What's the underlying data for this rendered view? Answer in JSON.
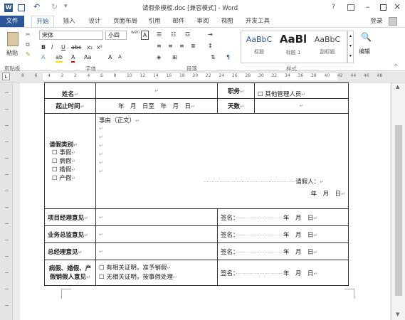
{
  "window": {
    "title": "请假条模板.doc [兼容模式] - Word",
    "help": "?",
    "signin": "登录"
  },
  "tabs": [
    "文件",
    "开始",
    "插入",
    "设计",
    "页面布局",
    "引用",
    "邮件",
    "审阅",
    "视图",
    "开发工具"
  ],
  "ribbon": {
    "paste": "粘贴",
    "font_name": "宋体",
    "font_size": "小四",
    "wen": "wén",
    "styles": [
      {
        "preview": "AaBbC",
        "name": "标题"
      },
      {
        "preview": "AaBl",
        "name": "标题 1"
      },
      {
        "preview": "AaBbC",
        "name": "副标题"
      }
    ],
    "edit": "编辑",
    "groups": [
      "剪贴板",
      "字体",
      "段落",
      "样式"
    ]
  },
  "ruler": {
    "marks": [
      "8",
      "6",
      "4",
      "2",
      "2",
      "4",
      "6",
      "8",
      "10",
      "12",
      "14",
      "16",
      "18",
      "20",
      "22",
      "24",
      "26",
      "28",
      "30",
      "32",
      "34",
      "36",
      "38",
      "40",
      "42",
      "44",
      "46",
      "48"
    ]
  },
  "form": {
    "name_label": "姓名",
    "position_label": "职务",
    "position_option": "其他管理人员",
    "time_label": "起止时间",
    "time_value": "年　月　日至　年　月　日",
    "days_label": "天数",
    "category_label": "请假类别",
    "categories": [
      "事假",
      "病假",
      "婚假",
      "产假"
    ],
    "reason_label": "事由（正文）",
    "applicant_label": "请假人：",
    "date_text": "年　月　日",
    "pm_opinion": "项目经理意见",
    "gm_opinion": "业务总监意见",
    "ceo_opinion": "总经理意见",
    "cancel_label": "病假、婚假、产假销假人意见",
    "cancel_options": [
      "有相关证明，准予销假",
      "无相关证明，按事假处理"
    ],
    "sign_label": "签名："
  }
}
